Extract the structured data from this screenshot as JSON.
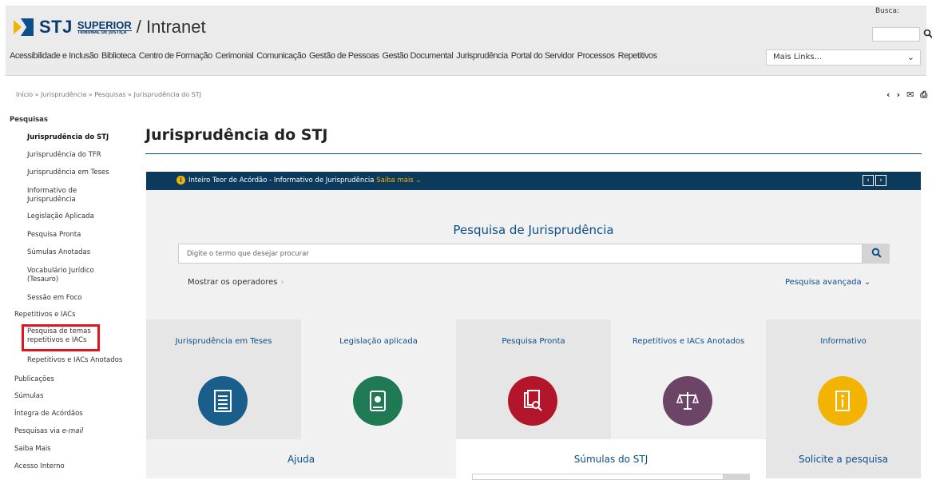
{
  "header": {
    "logo_stj": "STJ",
    "logo_superior": "SUPERIOR",
    "logo_tribunal": "TRIBUNAL DE JUSTIÇA",
    "title": "/ Intranet",
    "busca_label": "Busca:",
    "search_icon": "search-icon"
  },
  "topnav": {
    "links": [
      "Acessibilidade e Inclusão",
      "Biblioteca",
      "Centro de Formação",
      "Cerimonial",
      "Comunicação",
      "Gestão de Pessoas",
      "Gestão Documental",
      "Jurisprudência",
      "Portal do Servidor",
      "Processos",
      "Repetitivos"
    ],
    "mais_links": "Mais Links..."
  },
  "breadcrumb": "Início » Jurisprudência » Pesquisas » Jurisprudência do STJ",
  "pager": {
    "prev": "‹",
    "next": "›",
    "mail": "✉",
    "print": "⎙"
  },
  "sidebar": {
    "items": [
      {
        "label": "Pesquisas"
      },
      {
        "label": "Jurisprudência do STJ"
      },
      {
        "label": "Jurisprudência do TFR"
      },
      {
        "label": "Jurisprudência em Teses"
      },
      {
        "label": "Informativo de"
      },
      {
        "label": "Jurisprudência"
      },
      {
        "label": "Legislação Aplicada"
      },
      {
        "label": "Pesquisa Pronta"
      },
      {
        "label": "Súmulas Anotadas"
      },
      {
        "label": "Vocabulário Jurídico"
      },
      {
        "label": "(Tesauro)"
      },
      {
        "label": "Sessão em Foco"
      },
      {
        "label": "Repetitivos e IACs"
      },
      {
        "label": "Pesquisa de temas"
      },
      {
        "label": "repetitivos e IACs"
      },
      {
        "label": "Repetitivos e IACs Anotados"
      },
      {
        "label": "Publicações"
      },
      {
        "label": "Súmulas"
      },
      {
        "label": "Íntegra de Acórdãos"
      },
      {
        "label": "Pesquisas via "
      },
      {
        "label": "e-mail"
      },
      {
        "label": "Saiba Mais"
      },
      {
        "label": "Acesso Interno"
      }
    ]
  },
  "main": {
    "title": "Jurisprudência do STJ",
    "banner": {
      "text": "Inteiro Teor de Acórdão - Informativo de Jurisprudência ",
      "saiba_mais": "Saiba mais ⌄",
      "info_glyph": "i",
      "prev": "‹",
      "next": "›"
    },
    "search": {
      "title": "Pesquisa de Jurisprudência",
      "placeholder": "Digite o termo que desejar procurar",
      "mostrar": "Mostrar os operadores",
      "mostrar_arrow": "›",
      "avancada": "Pesquisa avançada ⌄"
    },
    "tiles": [
      {
        "label": "Jurisprudência em Teses",
        "color": "#1a5f8c",
        "icon": "document-icon"
      },
      {
        "label": "Legislação aplicada",
        "color": "#1f7a53",
        "icon": "book-icon"
      },
      {
        "label": "Pesquisa Pronta",
        "color": "#b3162a",
        "icon": "documents-search-icon"
      },
      {
        "label": "Repetitivos e IACs Anotados",
        "color": "#6b4466",
        "icon": "scales-icon"
      },
      {
        "label": "Informativo",
        "color": "#f2b400",
        "icon": "info-icon"
      }
    ],
    "bottom": {
      "ajuda": "Ajuda",
      "sumulas": "Súmulas do STJ",
      "solicite": "Solicite a pesquisa"
    }
  },
  "colors": {
    "brand": "#0b4f8a",
    "banner": "#0c3a5c",
    "highlight": "#e0141e",
    "accent": "#f2b400"
  }
}
